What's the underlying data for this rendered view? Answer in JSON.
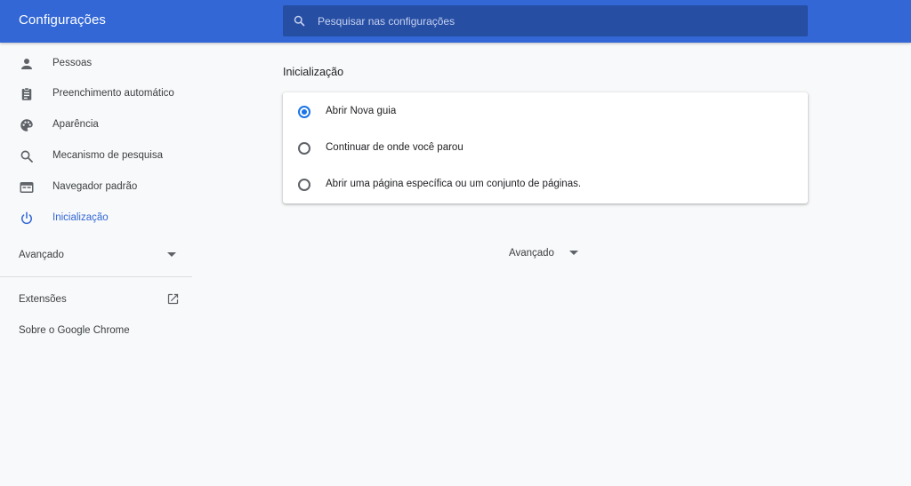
{
  "header": {
    "title": "Configurações",
    "search_placeholder": "Pesquisar nas configurações",
    "search_value": ""
  },
  "sidebar": {
    "items": [
      {
        "label": "Pessoas",
        "icon": "person-icon"
      },
      {
        "label": "Preenchimento automático",
        "icon": "clipboard-icon"
      },
      {
        "label": "Aparência",
        "icon": "palette-icon"
      },
      {
        "label": "Mecanismo de pesquisa",
        "icon": "search-icon"
      },
      {
        "label": "Navegador padrão",
        "icon": "browser-window-icon"
      },
      {
        "label": "Inicialização",
        "icon": "power-icon",
        "active": true
      }
    ],
    "advanced_label": "Avançado",
    "extensions_label": "Extensões",
    "about_label": "Sobre o Google Chrome"
  },
  "main": {
    "section_title": "Inicialização",
    "options": [
      {
        "label": "Abrir Nova guia",
        "checked": true
      },
      {
        "label": "Continuar de onde você parou",
        "checked": false
      },
      {
        "label": "Abrir uma página específica ou um conjunto de páginas.",
        "checked": false
      }
    ],
    "advanced_label": "Avançado"
  },
  "colors": {
    "header_bg": "#3367d6",
    "search_bg": "#264ea3",
    "accent": "#1a73e8",
    "page_bg": "#f8f9fa"
  }
}
